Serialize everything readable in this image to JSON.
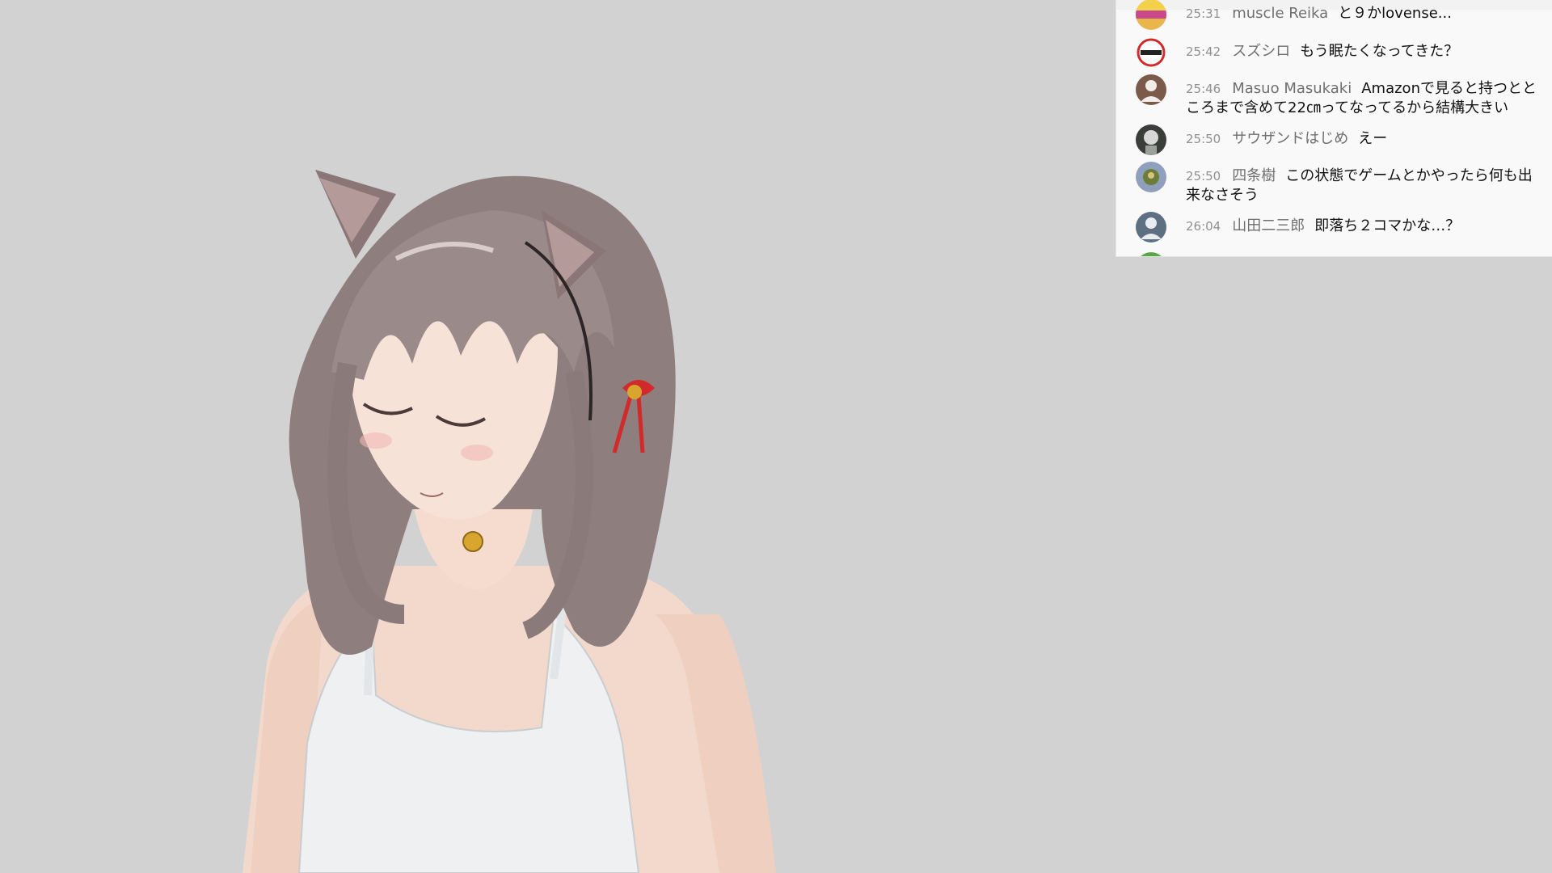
{
  "chat": {
    "messages": [
      {
        "time": "25:31",
        "author": "muscle Reika",
        "text": "と９かlovense...",
        "avatar_color": "#e8b64a"
      },
      {
        "time": "25:42",
        "author": "スズシロ",
        "text": "もう眠たくなってきた？",
        "avatar_color": "#ffffff"
      },
      {
        "time": "25:46",
        "author": "Masuo Masukaki",
        "text": "Amazonで見ると持つとところまで含めて22㎝ってなってるから結構大きい",
        "avatar_color": "#7b5a4b"
      },
      {
        "time": "25:50",
        "author": "サウザンドはじめ",
        "text": "えー",
        "avatar_color": "#3a3d3a"
      },
      {
        "time": "25:50",
        "author": "四条樹",
        "text": "この状態でゲームとかやったら何も出来なさそう",
        "avatar_color": "#8fa0bd"
      },
      {
        "time": "26:04",
        "author": "山田二三郎",
        "text": "即落ち２コマかな…？",
        "avatar_color": "#5d6f80"
      }
    ]
  },
  "colors": {
    "background": "#d2d2d2",
    "chat_bg": "#f9f9f9",
    "timestamp": "#909090",
    "author": "#6f6f6f"
  }
}
